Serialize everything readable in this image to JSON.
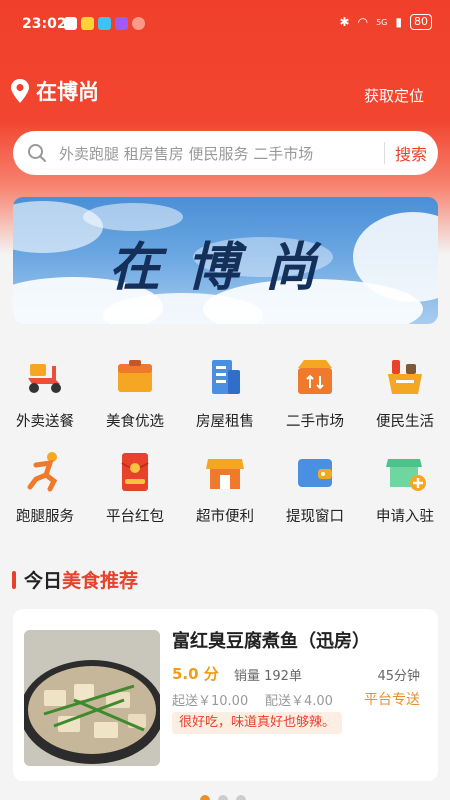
{
  "status_bar": {
    "time": "23:02",
    "battery": "80",
    "signal": "5G"
  },
  "header": {
    "location": "在博尚",
    "get_location": "获取定位"
  },
  "search": {
    "placeholder": "外卖跑腿 租房售房 便民服务 二手市场",
    "button": "搜索"
  },
  "banner": {
    "title": "在博尚"
  },
  "categories": [
    [
      {
        "label": "外卖送餐",
        "icon": "scooter-icon"
      },
      {
        "label": "美食优选",
        "icon": "food-box-icon"
      },
      {
        "label": "房屋租售",
        "icon": "building-icon"
      },
      {
        "label": "二手市场",
        "icon": "swap-store-icon"
      },
      {
        "label": "便民生活",
        "icon": "basket-icon"
      }
    ],
    [
      {
        "label": "跑腿服务",
        "icon": "runner-icon"
      },
      {
        "label": "平台红包",
        "icon": "red-packet-icon"
      },
      {
        "label": "超市便利",
        "icon": "shop-icon"
      },
      {
        "label": "提现窗口",
        "icon": "wallet-icon"
      },
      {
        "label": "申请入驻",
        "icon": "store-add-icon"
      }
    ]
  ],
  "section": {
    "title_prefix": "今日",
    "title_highlight": "美食推荐"
  },
  "recommend": {
    "name": "富红臭豆腐煮鱼（迅房）",
    "rating": "5.0 分",
    "sales": "销量 192单",
    "time": "45分钟",
    "min_price": "起送￥10.00",
    "delivery_fee": "配送￥4.00",
    "delivery_type": "平台专送",
    "review": "很好吃，味道真好也够辣。"
  },
  "colors": {
    "accent": "#e8412c",
    "header_red": "#f0402c",
    "orange": "#e8912c"
  }
}
